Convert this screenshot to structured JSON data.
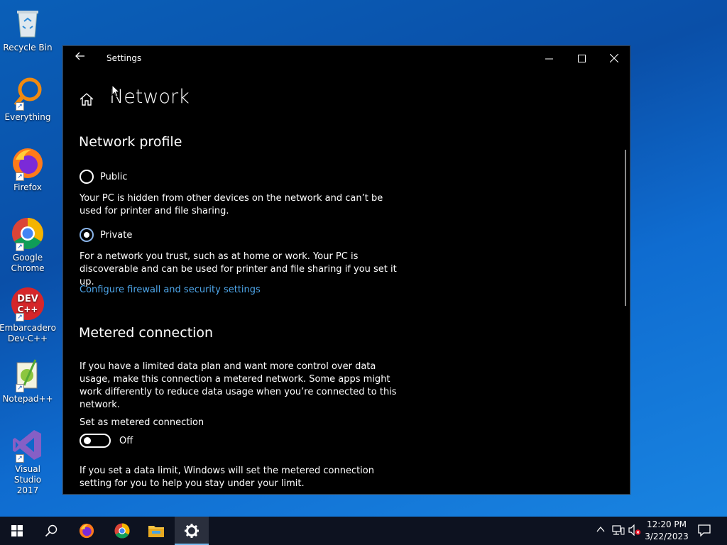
{
  "desktop": {
    "icons": [
      {
        "label": "Recycle Bin",
        "name": "recycle-bin"
      },
      {
        "label": "Everything",
        "name": "everything"
      },
      {
        "label": "Firefox",
        "name": "firefox"
      },
      {
        "label": "Google Chrome",
        "name": "google-chrome"
      },
      {
        "label": "Embarcadero Dev-C++",
        "name": "dev-cpp"
      },
      {
        "label": "Notepad++",
        "name": "notepad-plus-plus"
      },
      {
        "label": "Visual Studio 2017",
        "name": "visual-studio"
      }
    ],
    "devcpp_logo_text": "DEV C++"
  },
  "window": {
    "title": "Settings",
    "page_title": "Network",
    "network_profile": {
      "title": "Network profile",
      "public_label": "Public",
      "public_desc": "Your PC is hidden from other devices on the network and can’t be used for printer and file sharing.",
      "private_label": "Private",
      "private_desc": "For a network you trust, such as at home or work. Your PC is discoverable and can be used for printer and file sharing if you set it up.",
      "selected": "Private",
      "firewall_link": "Configure firewall and security settings"
    },
    "metered": {
      "title": "Metered connection",
      "desc": "If you have a limited data plan and want more control over data usage, make this connection a metered network. Some apps might work differently to reduce data usage when you’re connected to this network.",
      "toggle_label": "Set as metered connection",
      "toggle_state": "Off",
      "limit_desc": "If you set a data limit, Windows will set the metered connection setting for you to help you stay under your limit."
    }
  },
  "taskbar": {
    "time": "12:20 PM",
    "date": "3/22/2023",
    "pinned": [
      "start-icon",
      "search-icon",
      "firefox-icon",
      "chrome-icon",
      "file-explorer-icon",
      "settings-icon"
    ]
  },
  "colors": {
    "link": "#4ea6ea",
    "desktop": "#0a5fb8",
    "taskbar": "#0d1220"
  }
}
